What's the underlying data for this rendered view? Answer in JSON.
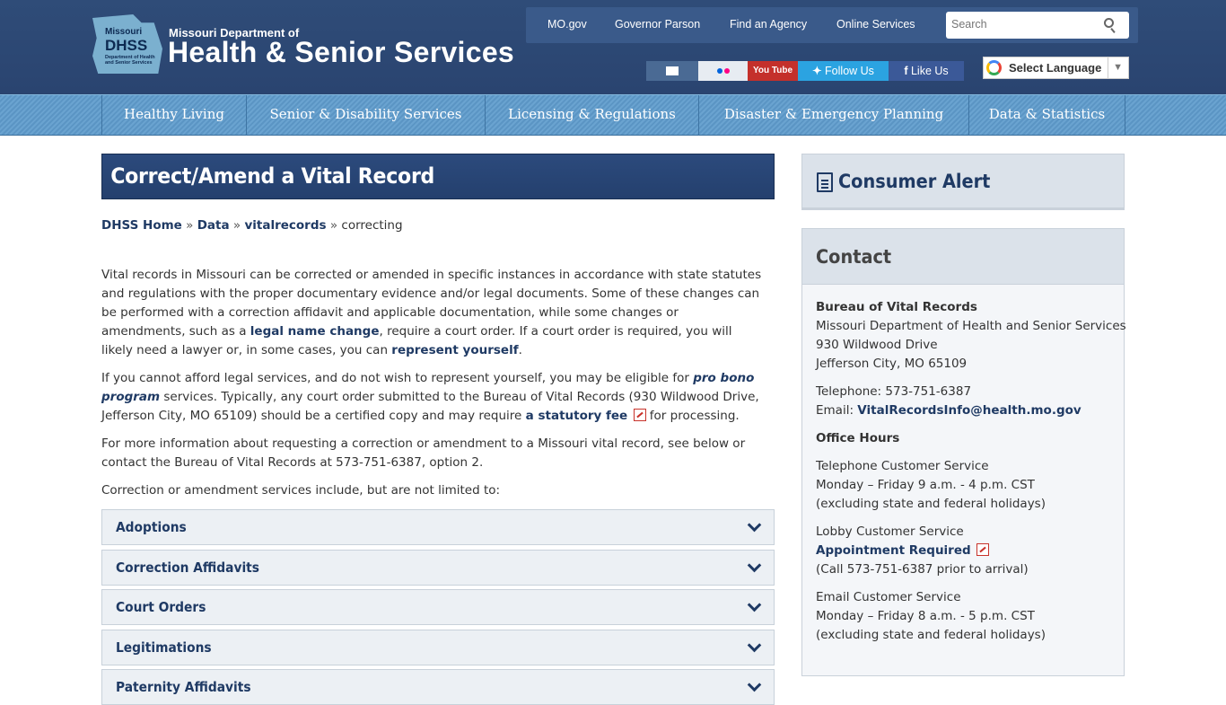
{
  "header": {
    "logo": {
      "badge_top": "Missouri",
      "badge_mid": "DHSS",
      "badge_small": "Department of Health and Senior Services",
      "line1": "Missouri Department of",
      "line2": "Health & Senior Services"
    },
    "topnav": [
      "MO.gov",
      "Governor Parson",
      "Find an Agency",
      "Online Services"
    ],
    "search_placeholder": "Search",
    "social": {
      "email_icon": "envelope-icon",
      "flickr_icon": "flickr-icon",
      "youtube": "You Tube",
      "twitter": "Follow Us",
      "facebook": "Like Us"
    },
    "translate": {
      "label": "Select Language",
      "arrow": "▼"
    },
    "colors": {
      "header_bg": "#2f4c78",
      "nav_bg": "#5b95c4",
      "accent": "#1f3a64"
    }
  },
  "mainnav": [
    "Healthy Living",
    "Senior & Disability Services",
    "Licensing & Regulations",
    "Disaster & Emergency Planning",
    "Data & Statistics"
  ],
  "page": {
    "title": "Correct/Amend a Vital Record",
    "breadcrumb": {
      "home": "DHSS Home",
      "sep": "»",
      "data": "Data",
      "vitalrecords": "vitalrecords",
      "current": "correcting"
    },
    "p1": {
      "a": "Vital records in Missouri can be corrected or amended in specific instances in accordance with state statutes and regulations with the proper documentary evidence and/or legal documents. Some of these changes can be performed with a correction affidavit and applicable documentation, while some changes or amendments, such as a ",
      "link1": "legal name change",
      "b": ", require a court order. If a court order is required, you will likely need a lawyer or, in some cases, you can ",
      "link2": "represent yourself",
      "c": "."
    },
    "p2": {
      "a": "If you cannot afford legal services, and do not wish to represent yourself, you may be eligible for ",
      "link1": "pro bono program",
      "b": " services. Typically, any court order submitted to the Bureau of Vital Records (930 Wildwood Drive, Jefferson City, MO 65109) should be a certified copy and may require ",
      "link2": "a statutory fee",
      "c": " for processing."
    },
    "p3": "For more information about requesting a correction or amendment to a Missouri vital record, see below or contact the Bureau of Vital Records at 573-751-6387, option 2.",
    "p4": "Correction or amendment services include, but are not limited to:",
    "accordion": [
      "Adoptions",
      "Correction Affidavits",
      "Court Orders",
      "Legitimations",
      "Paternity Affidavits"
    ]
  },
  "sidebar": {
    "alert_title": "Consumer Alert",
    "contact_title": "Contact",
    "bureau": "Bureau of Vital Records",
    "dept": "Missouri Department of Health and Senior Services",
    "street": "930 Wildwood Drive",
    "city": "Jefferson City, MO 65109",
    "phone": "Telephone: 573-751-6387",
    "email_label": "Email: ",
    "email": "VitalRecordsInfo@health.mo.gov",
    "hours_title": "Office Hours",
    "tel_service": "Telephone Customer Service",
    "tel_hours": "Monday – Friday 9 a.m. - 4 p.m. CST",
    "tel_excl": "(excluding state and federal holidays)",
    "lobby_service": "Lobby Customer Service",
    "appointment": "Appointment Required",
    "lobby_note": "(Call 573-751-6387 prior to arrival)",
    "email_service": "Email Customer Service",
    "email_hours": "Monday – Friday 8 a.m. - 5 p.m. CST",
    "email_excl": "(excluding state and federal holidays)"
  }
}
